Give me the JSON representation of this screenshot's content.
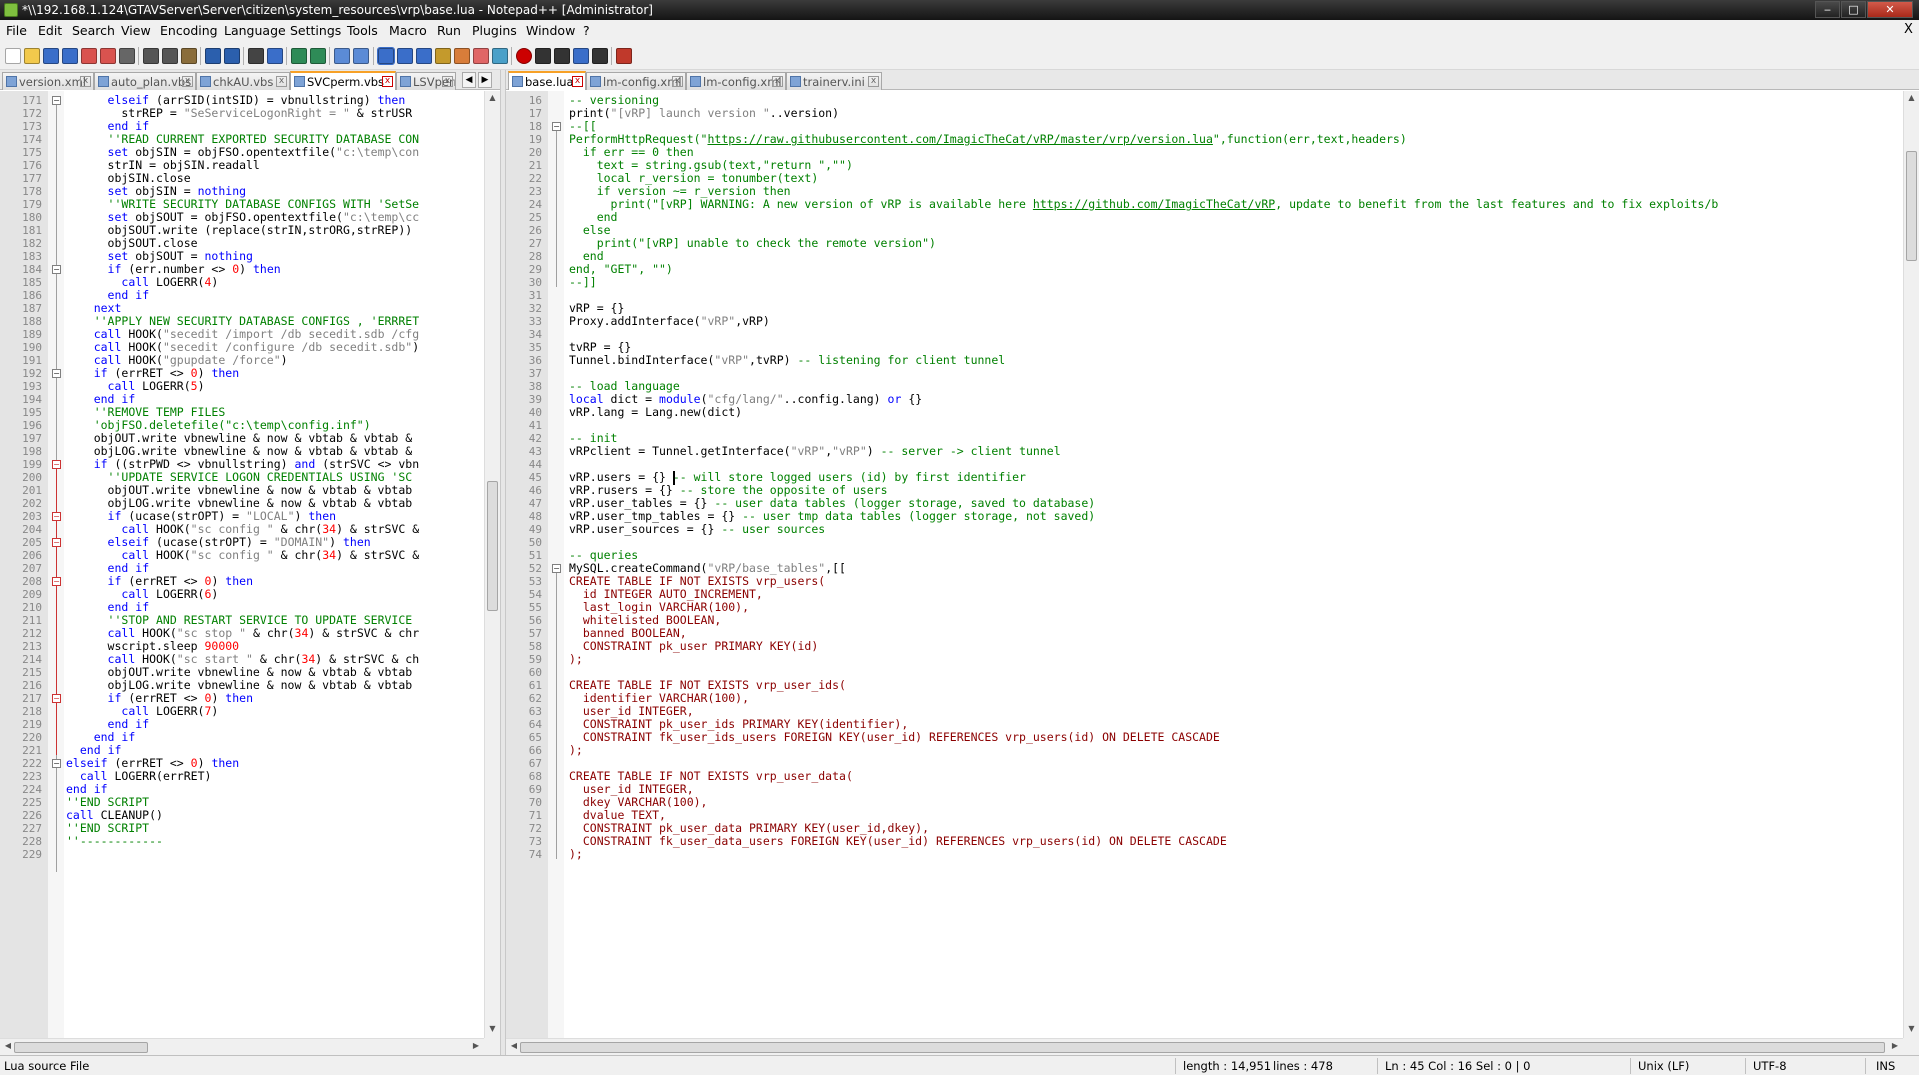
{
  "window": {
    "title": "*\\\\192.168.1.124\\GTAVServer\\Server\\citizen\\system_resources\\vrp\\base.lua - Notepad++ [Administrator]",
    "min_label": "‒",
    "max_label": "□",
    "close_label": "✕"
  },
  "menu": [
    "File",
    "Edit",
    "Search",
    "View",
    "Encoding",
    "Language",
    "Settings",
    "Tools",
    "Macro",
    "Run",
    "Plugins",
    "Window",
    "?"
  ],
  "menu_close": "X",
  "left_tabs": [
    {
      "label": "version.xml",
      "active": false
    },
    {
      "label": "auto_plan.vbs",
      "active": false
    },
    {
      "label": "chkAU.vbs",
      "active": false
    },
    {
      "label": "SVCperm.vbs",
      "active": true
    },
    {
      "label": "LSVperm",
      "active": false
    }
  ],
  "right_tabs": [
    {
      "label": "base.lua",
      "active": true
    },
    {
      "label": "lm-config.xml",
      "active": false
    },
    {
      "label": "lm-config.xml",
      "active": false
    },
    {
      "label": "trainerv.ini",
      "active": false
    }
  ],
  "left_lines": [
    {
      "n": 171,
      "t": "      elseif (arrSID(intSID) = vbnullstring) then"
    },
    {
      "n": 172,
      "t": "        strREP = \"SeServiceLogonRight = \" & strUSR"
    },
    {
      "n": 173,
      "t": "      end if"
    },
    {
      "n": 174,
      "t": "      ''READ CURRENT EXPORTED SECURITY DATABASE CON"
    },
    {
      "n": 175,
      "t": "      set objSIN = objFSO.opentextfile(\"c:\\temp\\con"
    },
    {
      "n": 176,
      "t": "      strIN = objSIN.readall"
    },
    {
      "n": 177,
      "t": "      objSIN.close"
    },
    {
      "n": 178,
      "t": "      set objSIN = nothing"
    },
    {
      "n": 179,
      "t": "      ''WRITE SECURITY DATABASE CONFIGS WITH 'SetSe"
    },
    {
      "n": 180,
      "t": "      set objSOUT = objFSO.opentextfile(\"c:\\temp\\cc"
    },
    {
      "n": 181,
      "t": "      objSOUT.write (replace(strIN,strORG,strREP))"
    },
    {
      "n": 182,
      "t": "      objSOUT.close"
    },
    {
      "n": 183,
      "t": "      set objSOUT = nothing"
    },
    {
      "n": 184,
      "t": "      if (err.number <> 0) then"
    },
    {
      "n": 185,
      "t": "        call LOGERR(4)"
    },
    {
      "n": 186,
      "t": "      end if"
    },
    {
      "n": 187,
      "t": "    next"
    },
    {
      "n": 188,
      "t": "    ''APPLY NEW SECURITY DATABASE CONFIGS , 'ERRRET"
    },
    {
      "n": 189,
      "t": "    call HOOK(\"secedit /import /db secedit.sdb /cfg"
    },
    {
      "n": 190,
      "t": "    call HOOK(\"secedit /configure /db secedit.sdb\")"
    },
    {
      "n": 191,
      "t": "    call HOOK(\"gpupdate /force\")"
    },
    {
      "n": 192,
      "t": "    if (errRET <> 0) then"
    },
    {
      "n": 193,
      "t": "      call LOGERR(5)"
    },
    {
      "n": 194,
      "t": "    end if"
    },
    {
      "n": 195,
      "t": "    ''REMOVE TEMP FILES"
    },
    {
      "n": 196,
      "t": "    'objFSO.deletefile(\"c:\\temp\\config.inf\")"
    },
    {
      "n": 197,
      "t": "    objOUT.write vbnewline & now & vbtab & vbtab &"
    },
    {
      "n": 198,
      "t": "    objLOG.write vbnewline & now & vbtab & vbtab &"
    },
    {
      "n": 199,
      "t": "    if ((strPWD <> vbnullstring) and (strSVC <> vbn"
    },
    {
      "n": 200,
      "t": "      ''UPDATE SERVICE LOGON CREDENTIALS USING 'SC"
    },
    {
      "n": 201,
      "t": "      objOUT.write vbnewline & now & vbtab & vbtab"
    },
    {
      "n": 202,
      "t": "      objLOG.write vbnewline & now & vbtab & vbtab"
    },
    {
      "n": 203,
      "t": "      if (ucase(strOPT) = \"LOCAL\") then"
    },
    {
      "n": 204,
      "t": "        call HOOK(\"sc config \" & chr(34) & strSVC &"
    },
    {
      "n": 205,
      "t": "      elseif (ucase(strOPT) = \"DOMAIN\") then"
    },
    {
      "n": 206,
      "t": "        call HOOK(\"sc config \" & chr(34) & strSVC &"
    },
    {
      "n": 207,
      "t": "      end if"
    },
    {
      "n": 208,
      "t": "      if (errRET <> 0) then"
    },
    {
      "n": 209,
      "t": "        call LOGERR(6)"
    },
    {
      "n": 210,
      "t": "      end if"
    },
    {
      "n": 211,
      "t": "      ''STOP AND RESTART SERVICE TO UPDATE SERVICE"
    },
    {
      "n": 212,
      "t": "      call HOOK(\"sc stop \" & chr(34) & strSVC & chr"
    },
    {
      "n": 213,
      "t": "      wscript.sleep 90000"
    },
    {
      "n": 214,
      "t": "      call HOOK(\"sc start \" & chr(34) & strSVC & ch"
    },
    {
      "n": 215,
      "t": "      objOUT.write vbnewline & now & vbtab & vbtab"
    },
    {
      "n": 216,
      "t": "      objLOG.write vbnewline & now & vbtab & vbtab"
    },
    {
      "n": 217,
      "t": "      if (errRET <> 0) then"
    },
    {
      "n": 218,
      "t": "        call LOGERR(7)"
    },
    {
      "n": 219,
      "t": "      end if"
    },
    {
      "n": 220,
      "t": "    end if"
    },
    {
      "n": 221,
      "t": "  end if"
    },
    {
      "n": 222,
      "t": "elseif (errRET <> 0) then"
    },
    {
      "n": 223,
      "t": "  call LOGERR(errRET)"
    },
    {
      "n": 224,
      "t": "end if"
    },
    {
      "n": 225,
      "t": "''END SCRIPT"
    },
    {
      "n": 226,
      "t": "call CLEANUP()"
    },
    {
      "n": 227,
      "t": "''END SCRIPT"
    },
    {
      "n": 228,
      "t": "''------------"
    },
    {
      "n": 229,
      "t": ""
    }
  ],
  "right_lines": [
    {
      "n": 16,
      "t": "-- versioning"
    },
    {
      "n": 17,
      "t": "print(\"[vRP] launch version \"..version)"
    },
    {
      "n": 18,
      "t": "--[["
    },
    {
      "n": 19,
      "t": "PerformHttpRequest(\"https://raw.githubusercontent.com/ImagicTheCat/vRP/master/vrp/version.lua\",function(err,text,headers)"
    },
    {
      "n": 20,
      "t": "  if err == 0 then"
    },
    {
      "n": 21,
      "t": "    text = string.gsub(text,\"return \",\"\")"
    },
    {
      "n": 22,
      "t": "    local r_version = tonumber(text)"
    },
    {
      "n": 23,
      "t": "    if version ~= r_version then"
    },
    {
      "n": 24,
      "t": "      print(\"[vRP] WARNING: A new version of vRP is available here https://github.com/ImagicTheCat/vRP, update to benefit from the last features and to fix exploits/b"
    },
    {
      "n": 25,
      "t": "    end"
    },
    {
      "n": 26,
      "t": "  else"
    },
    {
      "n": 27,
      "t": "    print(\"[vRP] unable to check the remote version\")"
    },
    {
      "n": 28,
      "t": "  end"
    },
    {
      "n": 29,
      "t": "end, \"GET\", \"\")"
    },
    {
      "n": 30,
      "t": "--]]"
    },
    {
      "n": 31,
      "t": ""
    },
    {
      "n": 32,
      "t": "vRP = {}"
    },
    {
      "n": 33,
      "t": "Proxy.addInterface(\"vRP\",vRP)"
    },
    {
      "n": 34,
      "t": ""
    },
    {
      "n": 35,
      "t": "tvRP = {}"
    },
    {
      "n": 36,
      "t": "Tunnel.bindInterface(\"vRP\",tvRP) -- listening for client tunnel"
    },
    {
      "n": 37,
      "t": ""
    },
    {
      "n": 38,
      "t": "-- load language"
    },
    {
      "n": 39,
      "t": "local dict = module(\"cfg/lang/\"..config.lang) or {}"
    },
    {
      "n": 40,
      "t": "vRP.lang = Lang.new(dict)"
    },
    {
      "n": 41,
      "t": ""
    },
    {
      "n": 42,
      "t": "-- init"
    },
    {
      "n": 43,
      "t": "vRPclient = Tunnel.getInterface(\"vRP\",\"vRP\") -- server -> client tunnel"
    },
    {
      "n": 44,
      "t": ""
    },
    {
      "n": 45,
      "t": "vRP.users = {} -- will store logged users (id) by first identifier"
    },
    {
      "n": 46,
      "t": "vRP.rusers = {} -- store the opposite of users"
    },
    {
      "n": 47,
      "t": "vRP.user_tables = {} -- user data tables (logger storage, saved to database)"
    },
    {
      "n": 48,
      "t": "vRP.user_tmp_tables = {} -- user tmp data tables (logger storage, not saved)"
    },
    {
      "n": 49,
      "t": "vRP.user_sources = {} -- user sources"
    },
    {
      "n": 50,
      "t": ""
    },
    {
      "n": 51,
      "t": "-- queries"
    },
    {
      "n": 52,
      "t": "MySQL.createCommand(\"vRP/base_tables\",[["
    },
    {
      "n": 53,
      "t": "CREATE TABLE IF NOT EXISTS vrp_users("
    },
    {
      "n": 54,
      "t": "  id INTEGER AUTO_INCREMENT,"
    },
    {
      "n": 55,
      "t": "  last_login VARCHAR(100),"
    },
    {
      "n": 56,
      "t": "  whitelisted BOOLEAN,"
    },
    {
      "n": 57,
      "t": "  banned BOOLEAN,"
    },
    {
      "n": 58,
      "t": "  CONSTRAINT pk_user PRIMARY KEY(id)"
    },
    {
      "n": 59,
      "t": ");"
    },
    {
      "n": 60,
      "t": ""
    },
    {
      "n": 61,
      "t": "CREATE TABLE IF NOT EXISTS vrp_user_ids("
    },
    {
      "n": 62,
      "t": "  identifier VARCHAR(100),"
    },
    {
      "n": 63,
      "t": "  user_id INTEGER,"
    },
    {
      "n": 64,
      "t": "  CONSTRAINT pk_user_ids PRIMARY KEY(identifier),"
    },
    {
      "n": 65,
      "t": "  CONSTRAINT fk_user_ids_users FOREIGN KEY(user_id) REFERENCES vrp_users(id) ON DELETE CASCADE"
    },
    {
      "n": 66,
      "t": ");"
    },
    {
      "n": 67,
      "t": ""
    },
    {
      "n": 68,
      "t": "CREATE TABLE IF NOT EXISTS vrp_user_data("
    },
    {
      "n": 69,
      "t": "  user_id INTEGER,"
    },
    {
      "n": 70,
      "t": "  dkey VARCHAR(100),"
    },
    {
      "n": 71,
      "t": "  dvalue TEXT,"
    },
    {
      "n": 72,
      "t": "  CONSTRAINT pk_user_data PRIMARY KEY(user_id,dkey),"
    },
    {
      "n": 73,
      "t": "  CONSTRAINT fk_user_data_users FOREIGN KEY(user_id) REFERENCES vrp_users(id) ON DELETE CASCADE"
    },
    {
      "n": 74,
      "t": ");"
    }
  ],
  "caret": {
    "line": 45,
    "col": 16
  },
  "status": {
    "file_type": "Lua source File",
    "length": "length : 14,951",
    "lines": "lines : 478",
    "position": "Ln : 45    Col : 16    Sel : 0 | 0",
    "eol": "Unix (LF)",
    "encoding": "UTF-8",
    "mode": "INS"
  },
  "toolbar_icons": [
    "new-file-icon",
    "open-file-icon",
    "save-icon",
    "save-all-icon",
    "close-icon",
    "close-all-icon",
    "print-icon",
    "cut-icon",
    "copy-icon",
    "paste-icon",
    "undo-icon",
    "redo-icon",
    "find-icon",
    "replace-icon",
    "zoom-in-icon",
    "zoom-out-icon",
    "sync-vertical-icon",
    "sync-horizontal-icon",
    "word-wrap-icon",
    "show-all-chars-icon",
    "indent-guide-icon",
    "doc-map-icon",
    "function-list-icon",
    "folder-workspace-icon",
    "monitoring-icon",
    "record-macro-icon",
    "stop-macro-icon",
    "play-macro-icon",
    "run-macro-multiple-icon",
    "save-macro-icon",
    "spellcheck-icon"
  ],
  "colors": {
    "keyword_vbs": "#0000ff",
    "string": "#808080",
    "number": "#ff0000",
    "comment": "#008000",
    "sql": "#8b0000",
    "active_tab_top": "#f7a127"
  }
}
